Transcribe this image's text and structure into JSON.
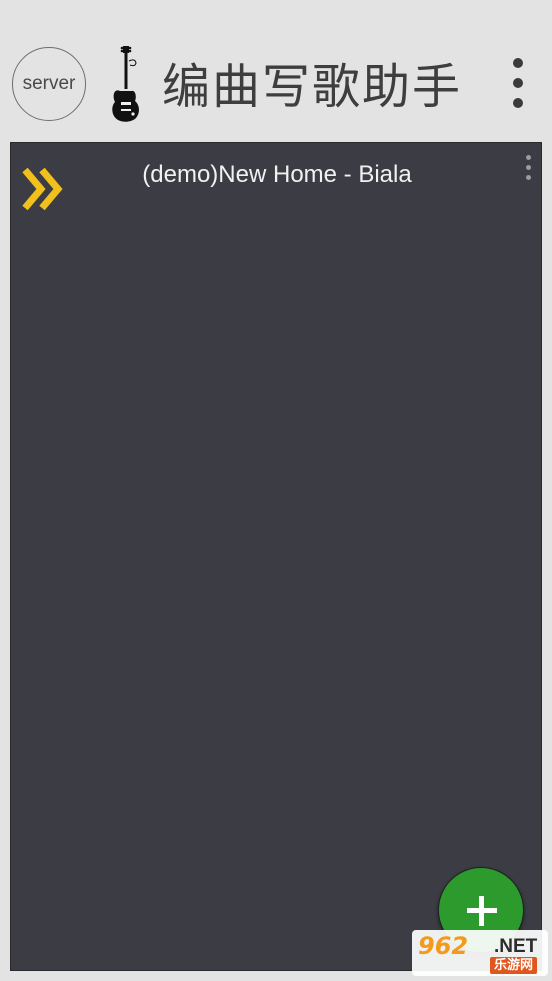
{
  "app_bar": {
    "server_label": "server",
    "logo_icon": "guitar-icon",
    "title": "编曲写歌助手",
    "menu_icon": "more-vert-icon"
  },
  "panel": {
    "expand_icon": "double-chevron-right-icon",
    "song_title": "(demo)New Home - Biala",
    "menu_icon": "more-vert-icon"
  },
  "fab": {
    "icon": "plus-icon"
  },
  "watermark": {
    "logo_text": "962",
    "domain_text": ".NET",
    "site_name": "乐游网"
  },
  "colors": {
    "app_bar_background": "#e2e3e2",
    "panel_background": "#3c3d44",
    "accent_yellow": "#f2c01c",
    "fab_green": "#2d9a2d"
  }
}
